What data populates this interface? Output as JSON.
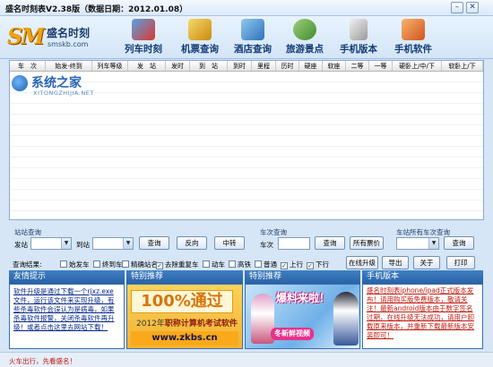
{
  "window": {
    "title": "盛名时刻表V2.38版（数据日期：2012.01.08）",
    "minimize_glyph": "–",
    "close_glyph": "✕"
  },
  "logo": {
    "mark": "SM",
    "name": "盛名时刻",
    "domain": "smskb.com"
  },
  "nav": [
    {
      "label": "列车时刻",
      "icon": "train-icon"
    },
    {
      "label": "机票查询",
      "icon": "ticket-icon"
    },
    {
      "label": "酒店查询",
      "icon": "hotel-icon"
    },
    {
      "label": "旅游景点",
      "icon": "globe-icon"
    },
    {
      "label": "手机版本",
      "icon": "phone-icon"
    },
    {
      "label": "手机软件",
      "icon": "software-icon"
    }
  ],
  "table": {
    "columns": [
      "车　次",
      "始发-终到",
      "列车等级",
      "发　站",
      "发时",
      "到　站",
      "到时",
      "里程",
      "历时",
      "硬座",
      "软座",
      "二等",
      "一等",
      "硬卧上/中/下",
      "软卧上/下"
    ],
    "rows": []
  },
  "watermark": {
    "name": "系统之家",
    "domain": "XITONGZHIJIA.NET"
  },
  "station_query": {
    "title": "站站查询",
    "from_label": "发站",
    "to_label": "到站",
    "from_value": "",
    "to_value": "",
    "query_button": "查询",
    "reverse_button": "反向",
    "transfer_button": "中转"
  },
  "train_query": {
    "title": "车次查询",
    "train_label": "车次",
    "train_value": "",
    "query_button": "查询",
    "all_fares_button": "所有票价"
  },
  "station_trains": {
    "title": "车站所有车次查询",
    "station_value": "",
    "query_button": "查询"
  },
  "filters": {
    "label": "查询结果:",
    "options": [
      {
        "label": "始发车",
        "checked": false
      },
      {
        "label": "终到车",
        "checked": false
      },
      {
        "label": "精确站名",
        "checked": false
      },
      {
        "label": "去除重复车",
        "checked": true
      },
      {
        "label": "动车",
        "checked": false
      },
      {
        "label": "高铁",
        "checked": false
      },
      {
        "label": "普通",
        "checked": false
      },
      {
        "label": "上行",
        "checked": true
      },
      {
        "label": "下行",
        "checked": true
      }
    ],
    "check_glyph": "✓",
    "online_update_button": "在线升级",
    "export_button": "导出",
    "about_button": "关于",
    "print_button": "打印"
  },
  "panels": {
    "tips_title": "友情提示",
    "tips_text": "软件升级是通过下载一个rjxz.exe文件，运行该文件来实现升级，有些杀毒软件会误认为是病毒，如果杀毒软件报警，关闭杀毒软件再升级！或者点击这里去网站下载！",
    "special1_title": "特别推荐",
    "special2_title": "特别推荐",
    "mobile_title": "手机版本",
    "mobile_text": "盛名时刻表iphone/ipad正式版本发布！请用购买版免费版本，敬请关注！最新android版本由于数字签名过期，在线升级无法成功，请用户卸载原来版本，并重新下载最新版本安装即可！"
  },
  "ads": {
    "exam_big": "100%通过",
    "exam_year": "2012年",
    "exam_title": "职称计算机考试软件",
    "exam_url": "www.zkbs.cn",
    "game_line1": "爆料来啦！",
    "game_line2": "冬新鲜视频"
  },
  "status": {
    "text": "火车出行，先看盛名！"
  }
}
